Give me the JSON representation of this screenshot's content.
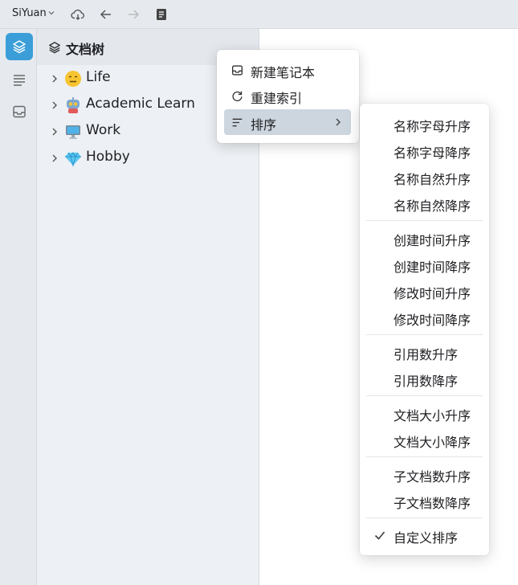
{
  "topbar": {
    "app_name": "SiYuan",
    "icons": [
      "cloud-sync-icon",
      "back-arrow-icon",
      "forward-arrow-icon",
      "notebook-icon"
    ]
  },
  "dock": {
    "items": [
      {
        "name": "file-tree",
        "icon": "layers-icon",
        "active": true
      },
      {
        "name": "outline",
        "icon": "outline-icon",
        "active": false
      },
      {
        "name": "inbox",
        "icon": "inbox-icon",
        "active": false
      }
    ]
  },
  "panel": {
    "title": "文档树",
    "notebooks": [
      {
        "label": "Life",
        "emoji": "😑"
      },
      {
        "label": "Academic Learn",
        "emoji": "🤖"
      },
      {
        "label": "Work",
        "emoji": "🖥️"
      },
      {
        "label": "Hobby",
        "emoji": "💎"
      }
    ]
  },
  "menu": {
    "items": [
      {
        "label": "新建笔记本",
        "icon": "inbox-icon"
      },
      {
        "label": "重建索引",
        "icon": "refresh-icon"
      },
      {
        "label": "排序",
        "icon": "sort-icon",
        "has_submenu": true
      }
    ]
  },
  "submenu": {
    "groups": [
      [
        "名称字母升序",
        "名称字母降序",
        "名称自然升序",
        "名称自然降序"
      ],
      [
        "创建时间升序",
        "创建时间降序",
        "修改时间升序",
        "修改时间降序"
      ],
      [
        "引用数升序",
        "引用数降序"
      ],
      [
        "文档大小升序",
        "文档大小降序"
      ],
      [
        "子文档数升序",
        "子文档数降序"
      ],
      [
        "自定义排序"
      ]
    ],
    "checked": "自定义排序"
  },
  "colors": {
    "accent": "#3b9ed8",
    "hover": "#cdd6df",
    "panel_bg": "#edf0f4",
    "topbar_bg": "#e6eaef"
  }
}
